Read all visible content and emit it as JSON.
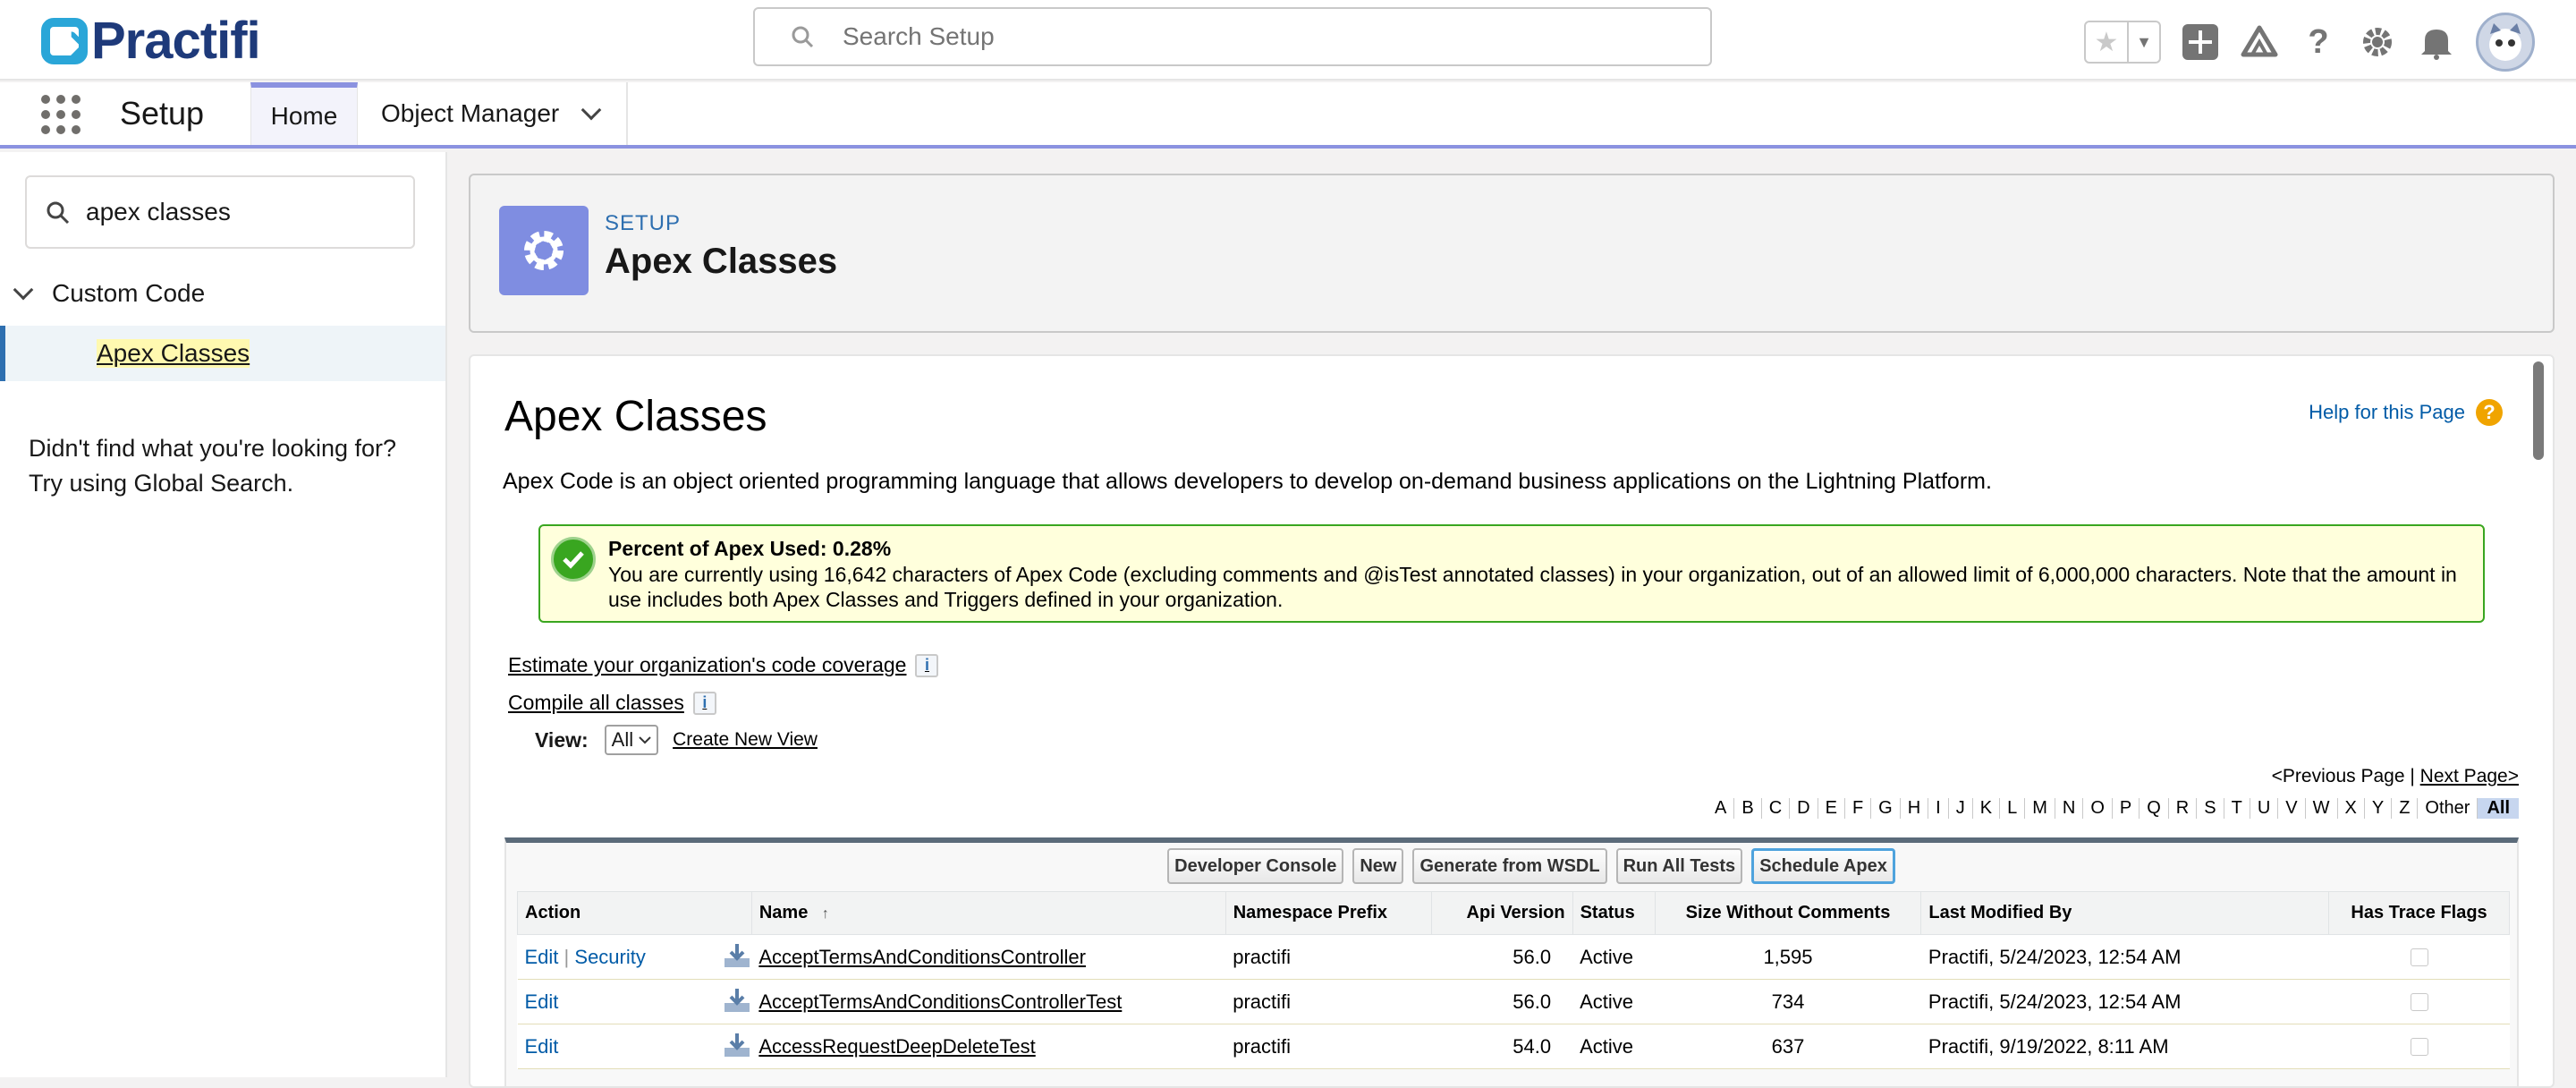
{
  "brand": {
    "name": "Practifi"
  },
  "search": {
    "placeholder": "Search Setup"
  },
  "nav": {
    "title": "Setup",
    "tabs": [
      {
        "label": "Home"
      },
      {
        "label": "Object Manager"
      }
    ]
  },
  "sidebar": {
    "search_value": "apex classes",
    "group": "Custom Code",
    "item": "Apex Classes",
    "help_text": "Didn't find what you're looking for? Try using Global Search."
  },
  "header": {
    "kicker": "SETUP",
    "title": "Apex Classes"
  },
  "main": {
    "title": "Apex Classes",
    "help_link": "Help for this Page",
    "description": "Apex Code is an object oriented programming language that allows developers to develop on-demand business applications on the Lightning Platform.",
    "usage_title": "Percent of Apex Used: 0.28%",
    "usage_text": "You are currently using 16,642 characters of Apex Code (excluding comments and @isTest annotated classes) in your organization, out of an allowed limit of 6,000,000 characters. Note that the amount in use includes both Apex Classes and Triggers defined in your organization.",
    "link_coverage": "Estimate your organization's code coverage",
    "link_compile": "Compile all classes",
    "view_label": "View:",
    "view_value": "All",
    "create_view": "Create New View",
    "prev_page": "<Previous Page",
    "next_page": "Next Page>",
    "pager_sep": "|",
    "letters": [
      "A",
      "B",
      "C",
      "D",
      "E",
      "F",
      "G",
      "H",
      "I",
      "J",
      "K",
      "L",
      "M",
      "N",
      "O",
      "P",
      "Q",
      "R",
      "S",
      "T",
      "U",
      "V",
      "W",
      "X",
      "Y",
      "Z",
      "Other",
      "All"
    ]
  },
  "buttons": [
    "Developer Console",
    "New",
    "Generate from WSDL",
    "Run All Tests",
    "Schedule Apex"
  ],
  "table": {
    "columns": [
      "Action",
      "Name",
      "Namespace Prefix",
      "Api Version",
      "Status",
      "Size Without Comments",
      "Last Modified By",
      "Has Trace Flags"
    ],
    "sort_indicator": "↑",
    "action_edit": "Edit",
    "action_security": "Security",
    "action_sep": "|",
    "rows": [
      {
        "name": "AcceptTermsAndConditionsController",
        "namespace": "practifi",
        "api": "56.0",
        "status": "Active",
        "size": "1,595",
        "modified": "Practifi, 5/24/2023, 12:54 AM"
      },
      {
        "name": "AcceptTermsAndConditionsControllerTest",
        "namespace": "practifi",
        "api": "56.0",
        "status": "Active",
        "size": "734",
        "modified": "Practifi, 5/24/2023, 12:54 AM"
      },
      {
        "name": "AccessRequestDeepDeleteTest",
        "namespace": "practifi",
        "api": "54.0",
        "status": "Active",
        "size": "637",
        "modified": "Practifi, 9/19/2022, 8:11 AM"
      }
    ]
  },
  "colors": {
    "accent": "#8b92e0",
    "link": "#015ba7",
    "success": "#39a620",
    "brand": "#1e3a7a"
  },
  "icons": [
    "search-icon",
    "star-icon",
    "plus-icon",
    "trailhead-icon",
    "help-icon",
    "gear-icon",
    "bell-icon",
    "avatar",
    "app-launcher-icon",
    "chevron-down-icon",
    "info-icon",
    "download-icon",
    "checkmark-icon"
  ]
}
